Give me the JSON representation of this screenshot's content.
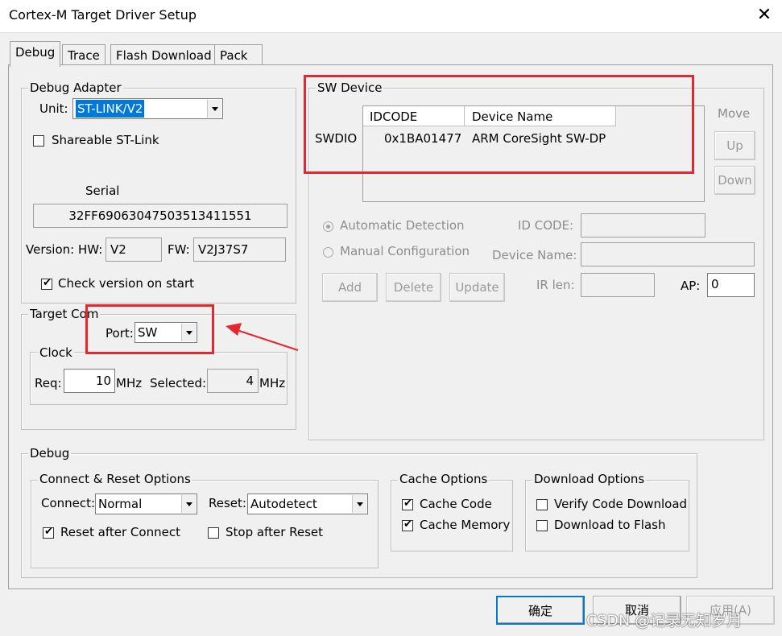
{
  "window": {
    "title": "Cortex-M Target Driver Setup",
    "close_glyph": "✕"
  },
  "tabs": [
    "Debug",
    "Trace",
    "Flash Download",
    "Pack"
  ],
  "debug_adapter": {
    "label": "Debug Adapter",
    "unit_label": "Unit:",
    "unit_value": "ST-LINK/V2",
    "shareable_label": "Shareable ST-Link",
    "shareable_checked": false,
    "serial_label": "Serial",
    "serial_value": "32FF69063047503513411551",
    "version_label": "Version: HW:",
    "hw_value": "V2",
    "fw_label": "FW:",
    "fw_value": "V2J37S7",
    "check_version_label": "Check version on start",
    "check_version_checked": true
  },
  "target_com": {
    "label": "Target Com",
    "port_label": "Port:",
    "port_value": "SW",
    "clock_label": "Clock",
    "req_label": "Req:",
    "req_value": "10",
    "req_unit": "MHz",
    "selected_label": "Selected:",
    "selected_value": "4",
    "selected_unit": "MHz"
  },
  "sw_device": {
    "label": "SW Device",
    "row_label": "SWDIO",
    "col_idcode": "IDCODE",
    "col_device_name": "Device Name",
    "idcode": "0x1BA01477",
    "device_name": "ARM CoreSight SW-DP",
    "move_label": "Move",
    "up_label": "Up",
    "down_label": "Down",
    "auto_label": "Automatic Detection",
    "manual_label": "Manual Configuration",
    "id_code_label": "ID CODE:",
    "device_name_label": "Device Name:",
    "add_label": "Add",
    "delete_label": "Delete",
    "update_label": "Update",
    "ir_len_label": "IR len:",
    "ap_label": "AP:",
    "ap_value": "0"
  },
  "debug_section": {
    "label": "Debug",
    "connect_reset_label": "Connect & Reset Options",
    "connect_label": "Connect:",
    "connect_value": "Normal",
    "reset_label": "Reset:",
    "reset_value": "Autodetect",
    "reset_after_connect_label": "Reset after Connect",
    "reset_after_connect_checked": true,
    "stop_after_reset_label": "Stop after Reset",
    "stop_after_reset_checked": false,
    "cache_options_label": "Cache Options",
    "cache_code_label": "Cache Code",
    "cache_code_checked": true,
    "cache_memory_label": "Cache Memory",
    "cache_memory_checked": true,
    "download_options_label": "Download Options",
    "verify_code_label": "Verify Code Download",
    "verify_code_checked": false,
    "download_flash_label": "Download to Flash",
    "download_flash_checked": false
  },
  "footer": {
    "ok_label": "确定",
    "cancel_label": "取消",
    "apply_label": "应用(A)",
    "watermark": "CSDN @记录无知岁月"
  },
  "annotation_color": "#e5282f"
}
